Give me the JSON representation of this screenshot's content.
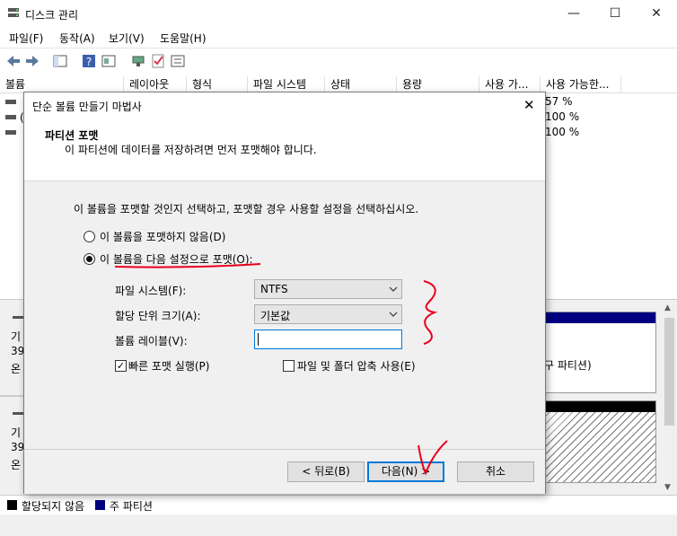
{
  "window": {
    "title": "디스크 관리",
    "controls": {
      "minimize": "—",
      "maximize": "☐",
      "close": "✕"
    }
  },
  "menu": [
    "파일(F)",
    "동작(A)",
    "보기(V)",
    "도움말(H)"
  ],
  "table": {
    "columns": [
      "볼륨",
      "레이아웃",
      "형식",
      "파일 시스템",
      "상태",
      "용량",
      "사용 가...",
      "사용 가능한..."
    ],
    "rows": [
      {
        "percent": "57 %"
      },
      {
        "percent": "100 %"
      },
      {
        "percent": "100 %"
      }
    ],
    "row_prefix": "("
  },
  "disk_panels": [
    {
      "lines": [
        "기",
        "39",
        "온"
      ]
    },
    {
      "lines": [
        "기",
        "39",
        "온"
      ]
    }
  ],
  "partition_label_fragment": "구 파티션)",
  "legend": [
    {
      "label": "할당되지 않음",
      "color": "#000000"
    },
    {
      "label": "주 파티션",
      "color": "#000080"
    }
  ],
  "dialog": {
    "title": "단순 볼륨 만들기 마법사",
    "close": "✕",
    "header_title": "파티션 포맷",
    "header_subtitle": "이 파티션에 데이터를 저장하려면 먼저 포맷해야 합니다.",
    "instruction": "이 볼륨을 포맷할 것인지 선택하고, 포맷할 경우 사용할 설정을 선택하십시오.",
    "radio_no_format": "이 볼륨을 포맷하지 않음(D)",
    "radio_format": "이 볼륨을 다음 설정으로 포맷(O):",
    "fields": {
      "filesystem_label": "파일 시스템(F):",
      "filesystem_value": "NTFS",
      "alloc_label": "할당 단위 크기(A):",
      "alloc_value": "기본값",
      "volume_label_label": "볼륨 레이블(V):",
      "volume_label_value": ""
    },
    "quick_format": "빠른 포맷 실행(P)",
    "compression": "파일 및 폴더 압축 사용(E)",
    "buttons": {
      "back": "< 뒤로(B)",
      "next": "다음(N) >",
      "cancel": "취소"
    }
  },
  "colors": {
    "annotation": "#e8001e",
    "accent": "#0078d7",
    "primary_partition": "#000080"
  }
}
